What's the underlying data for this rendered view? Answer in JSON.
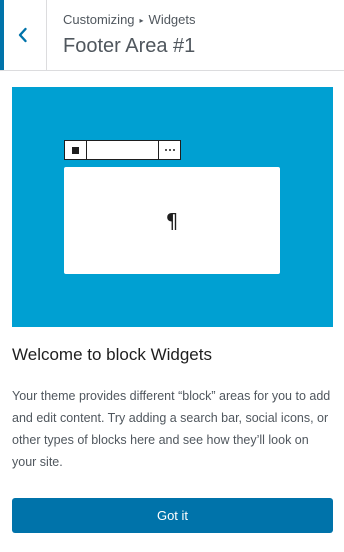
{
  "header": {
    "breadcrumb_root": "Customizing",
    "breadcrumb_separator": "▸",
    "breadcrumb_section": "Widgets",
    "title": "Footer Area #1",
    "back_icon": "chevron-left-icon"
  },
  "illustration": {
    "pilcrow": "¶",
    "background_color": "#00a0d2"
  },
  "welcome": {
    "heading": "Welcome to block Widgets",
    "description": "Your theme provides different “block” areas for you to add and edit content. Try adding a search bar, social icons, or other types of blocks here and see how they’ll look on your site.",
    "button_label": "Got it"
  },
  "colors": {
    "accent": "#0073aa",
    "text": "#1e1e1e",
    "muted_text": "#50575e"
  }
}
